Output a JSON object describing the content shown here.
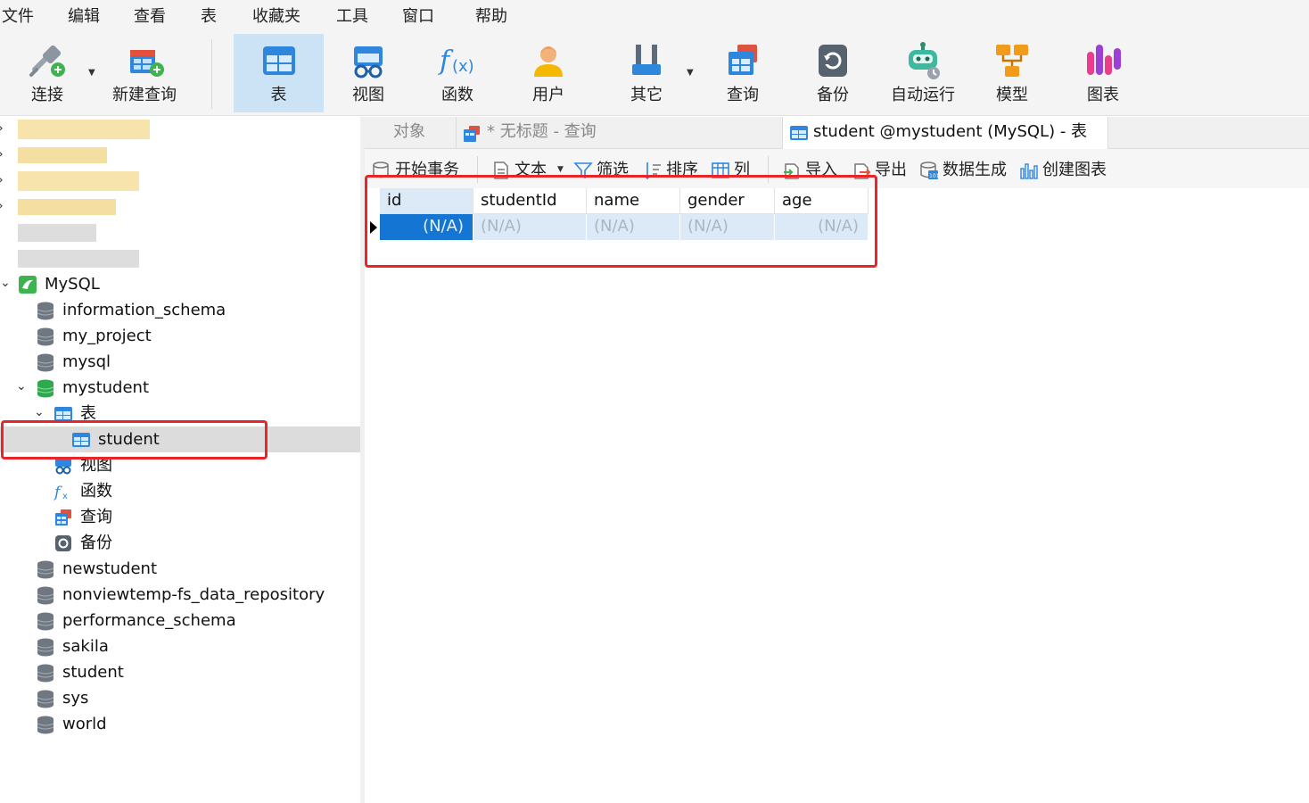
{
  "menu": [
    "文件",
    "编辑",
    "查看",
    "表",
    "收藏夹",
    "工具",
    "窗口",
    "帮助"
  ],
  "toolbar": {
    "items": [
      {
        "label": "连接",
        "icon": "connection-icon",
        "has_dropdown": true
      },
      {
        "label": "新建查询",
        "icon": "new-query-icon",
        "has_dropdown": false
      },
      {
        "label": "表",
        "icon": "table-icon",
        "active": true
      },
      {
        "label": "视图",
        "icon": "view-icon"
      },
      {
        "label": "函数",
        "icon": "function-icon"
      },
      {
        "label": "用户",
        "icon": "user-icon"
      },
      {
        "label": "其它",
        "icon": "tools-icon",
        "has_dropdown": true
      },
      {
        "label": "查询",
        "icon": "query-icon"
      },
      {
        "label": "备份",
        "icon": "backup-icon"
      },
      {
        "label": "自动运行",
        "icon": "robot-icon"
      },
      {
        "label": "模型",
        "icon": "model-icon"
      },
      {
        "label": "图表",
        "icon": "chart-icon"
      }
    ]
  },
  "sidebar": {
    "connection": "MySQL",
    "databases": [
      {
        "name": "information_schema"
      },
      {
        "name": "my_project"
      },
      {
        "name": "mysql"
      },
      {
        "name": "mystudent",
        "expanded": true
      },
      {
        "name": "newstudent"
      },
      {
        "name": "nonviewtemp-fs_data_repository"
      },
      {
        "name": "performance_schema"
      },
      {
        "name": "sakila"
      },
      {
        "name": "student"
      },
      {
        "name": "sys"
      },
      {
        "name": "world"
      }
    ],
    "mystudent_children": {
      "tables_group": "表",
      "table_selected": "student",
      "views": "视图",
      "functions": "函数",
      "queries": "查询",
      "backups": "备份"
    }
  },
  "tabs": [
    {
      "label": "对象"
    },
    {
      "label": "* 无标题 - 查询"
    },
    {
      "label": "student @mystudent (MySQL) - 表",
      "active": true
    }
  ],
  "subtoolbar": {
    "begin_transaction": "开始事务",
    "text": "文本",
    "filter": "筛选",
    "sort": "排序",
    "columns": "列",
    "import": "导入",
    "export": "导出",
    "data_generation": "数据生成",
    "create_chart": "创建图表"
  },
  "grid": {
    "columns": [
      "id",
      "studentId",
      "name",
      "gender",
      "age"
    ],
    "rows": [
      [
        "(N/A)",
        "(N/A)",
        "(N/A)",
        "(N/A)",
        "(N/A)"
      ]
    ]
  },
  "colors": {
    "accent": "#1475d2",
    "highlight": "#e8262a",
    "selected_row": "#dce9f6",
    "active_tool": "#cce3f6"
  }
}
